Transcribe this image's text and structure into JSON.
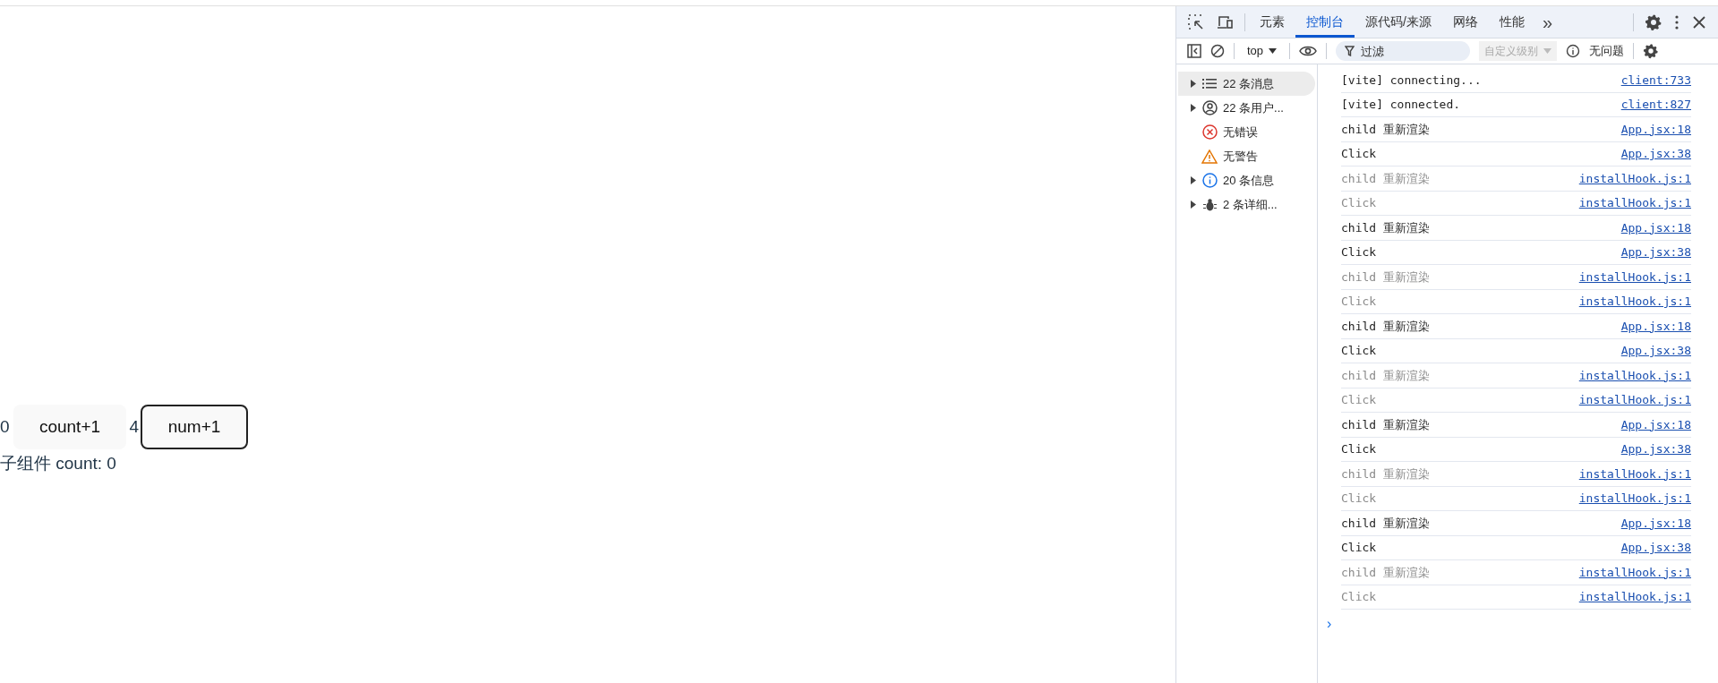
{
  "page": {
    "count_value": "0",
    "count_button": "count+1",
    "num_value": "4",
    "num_button": "num+1",
    "child_text": "子组件 count: 0"
  },
  "devtools": {
    "tabs": [
      {
        "label": "元素",
        "selected": false
      },
      {
        "label": "控制台",
        "selected": true
      },
      {
        "label": "源代码/来源",
        "selected": false
      },
      {
        "label": "网络",
        "selected": false
      },
      {
        "label": "性能",
        "selected": false
      }
    ],
    "more_tabs": "»",
    "toolbar": {
      "context": "top",
      "filter_placeholder": "过滤",
      "levels": "自定义级别",
      "issues": "无问题"
    },
    "sidebar": [
      {
        "kind": "messages",
        "label": "22 条消息",
        "expandable": true,
        "selected": true
      },
      {
        "kind": "user",
        "label": "22 条用户...",
        "expandable": true,
        "selected": false
      },
      {
        "kind": "error",
        "label": "无错误",
        "expandable": false,
        "selected": false
      },
      {
        "kind": "warning",
        "label": "无警告",
        "expandable": false,
        "selected": false
      },
      {
        "kind": "info",
        "label": "20 条信息",
        "expandable": true,
        "selected": false
      },
      {
        "kind": "verbose",
        "label": "2 条详细...",
        "expandable": true,
        "selected": false
      }
    ],
    "logs": [
      {
        "text": "[vite] connecting...",
        "source": "client:733",
        "dimmed": false
      },
      {
        "text": "[vite] connected.",
        "source": "client:827",
        "dimmed": false
      },
      {
        "text": "child 重新渲染",
        "source": "App.jsx:18",
        "dimmed": false
      },
      {
        "text": "Click",
        "source": "App.jsx:38",
        "dimmed": false
      },
      {
        "text": "child 重新渲染",
        "source": "installHook.js:1",
        "dimmed": true
      },
      {
        "text": "Click",
        "source": "installHook.js:1",
        "dimmed": true
      },
      {
        "text": "child 重新渲染",
        "source": "App.jsx:18",
        "dimmed": false
      },
      {
        "text": "Click",
        "source": "App.jsx:38",
        "dimmed": false
      },
      {
        "text": "child 重新渲染",
        "source": "installHook.js:1",
        "dimmed": true
      },
      {
        "text": "Click",
        "source": "installHook.js:1",
        "dimmed": true
      },
      {
        "text": "child 重新渲染",
        "source": "App.jsx:18",
        "dimmed": false
      },
      {
        "text": "Click",
        "source": "App.jsx:38",
        "dimmed": false
      },
      {
        "text": "child 重新渲染",
        "source": "installHook.js:1",
        "dimmed": true
      },
      {
        "text": "Click",
        "source": "installHook.js:1",
        "dimmed": true
      },
      {
        "text": "child 重新渲染",
        "source": "App.jsx:18",
        "dimmed": false
      },
      {
        "text": "Click",
        "source": "App.jsx:38",
        "dimmed": false
      },
      {
        "text": "child 重新渲染",
        "source": "installHook.js:1",
        "dimmed": true
      },
      {
        "text": "Click",
        "source": "installHook.js:1",
        "dimmed": true
      },
      {
        "text": "child 重新渲染",
        "source": "App.jsx:18",
        "dimmed": false
      },
      {
        "text": "Click",
        "source": "App.jsx:38",
        "dimmed": false
      },
      {
        "text": "child 重新渲染",
        "source": "installHook.js:1",
        "dimmed": true
      },
      {
        "text": "Click",
        "source": "installHook.js:1",
        "dimmed": true
      }
    ],
    "prompt": "›"
  }
}
